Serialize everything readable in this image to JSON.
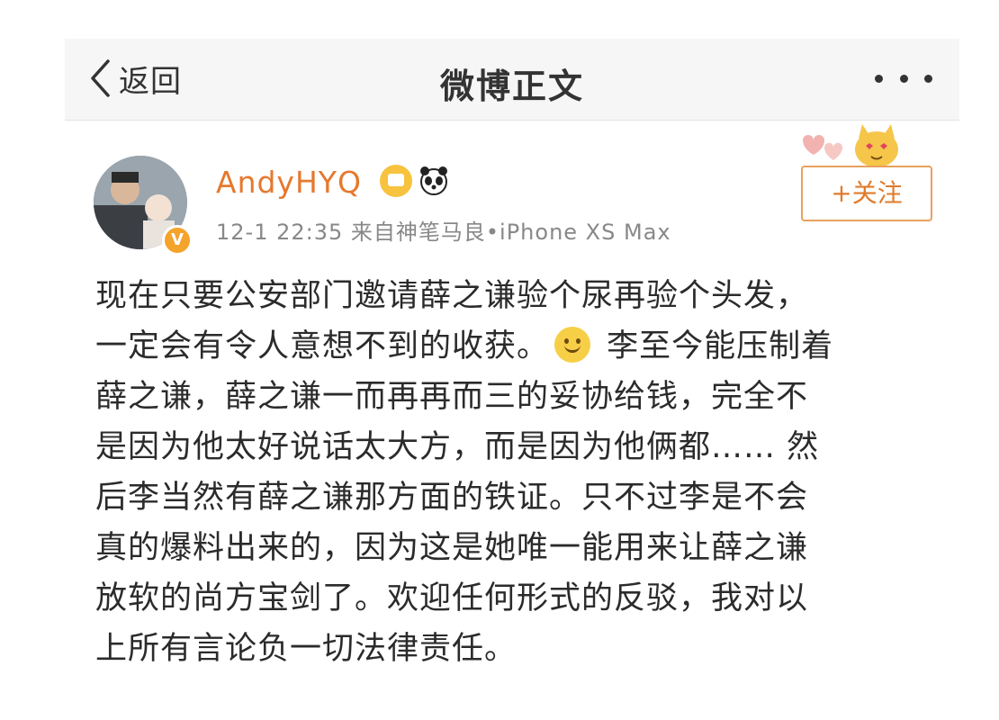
{
  "navbar": {
    "back_label": "返回",
    "title": "微博正文"
  },
  "user": {
    "name": "AndyHYQ",
    "verify_badge": "V",
    "meta": "12-1 22:35  来自神笔马良•iPhone XS Max",
    "follow_label": "+关注"
  },
  "post": {
    "lines": [
      "现在只要公安部门邀请薛之谦验个尿再验个头发，",
      "一定会有令人意想不到的收获。",
      "李至今能压制着",
      "薛之谦，薛之谦一而再再而三的妥协给钱，完全不",
      "是因为他太好说话太大方，而是因为他俩都…… 然",
      "后李当然有薛之谦那方面的铁证。只不过李是不会",
      "真的爆料出来的，因为这是她唯一能用来让薛之谦",
      "放软的尚方宝剑了。欢迎任何形式的反驳，我对以",
      "上所有言论负一切法律责任。"
    ]
  },
  "colors": {
    "username": "#e5792e",
    "follow_border": "#e7a15d",
    "navbar_bg": "#f6f6f6"
  },
  "icons": [
    "back-chevron-icon",
    "more-dots-icon",
    "crown-badge-icon",
    "panda-badge-icon",
    "smile-emoji-icon",
    "verified-badge-icon"
  ]
}
